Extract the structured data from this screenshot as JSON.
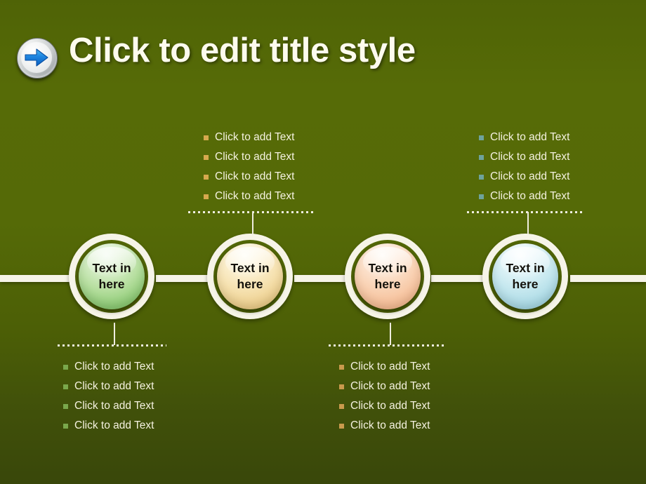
{
  "slide": {
    "title": "Click to edit title style",
    "title_icon": "arrow-right-circle-icon",
    "background_top_color": "#566b07",
    "background_bottom_color": "#39470a",
    "rail_color": "#f6f4e8"
  },
  "nodes": [
    {
      "label_line1": "Text in",
      "label_line2": "here",
      "color": "#8ecb76",
      "color_name": "green",
      "ring_position": "under"
    },
    {
      "label_line1": "Text in",
      "label_line2": "here",
      "color": "#eccd8a",
      "color_name": "tan",
      "ring_position": "over"
    },
    {
      "label_line1": "Text in",
      "label_line2": "here",
      "color": "#f5bb93",
      "color_name": "orange",
      "ring_position": "under"
    },
    {
      "label_line1": "Text in",
      "label_line2": "here",
      "color": "#a7d8e4",
      "color_name": "blue",
      "ring_position": "over"
    }
  ],
  "bullet_groups": [
    {
      "id": "top-center",
      "bullet_color": "#d6a94e",
      "items": [
        "Click to add Text",
        "Click to add Text",
        "Click to add Text",
        "Click to add Text"
      ]
    },
    {
      "id": "top-right",
      "bullet_color": "#6fa39c",
      "items": [
        "Click to add Text",
        "Click to add Text",
        "Click to add Text",
        "Click to add Text"
      ]
    },
    {
      "id": "bottom-left",
      "bullet_color": "#7aa84c",
      "items": [
        "Click to add Text",
        "Click to add Text",
        "Click to add Text",
        "Click to add Text"
      ]
    },
    {
      "id": "bottom-right",
      "bullet_color": "#c99a4d",
      "items": [
        "Click to add Text",
        "Click to add Text",
        "Click to add Text",
        "Click to add Text"
      ]
    }
  ]
}
